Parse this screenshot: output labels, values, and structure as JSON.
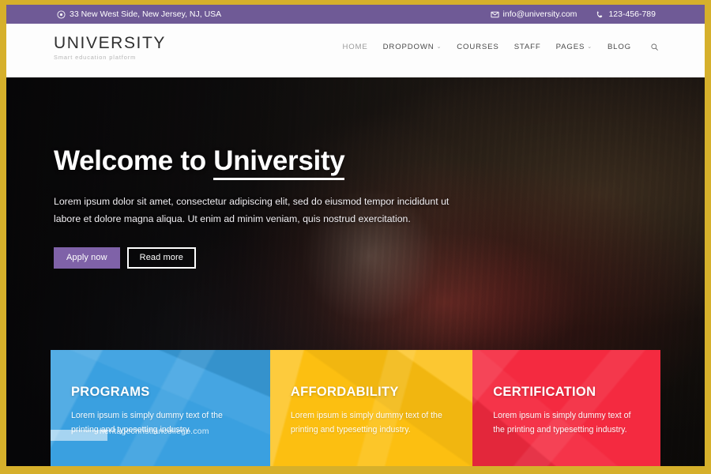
{
  "theme": {
    "frame_border": "#d6b02b",
    "topbar_bg": "#6f5a96",
    "accent_purple": "#7f62a8",
    "card_blue": "#3aa0e0",
    "card_yellow": "#fcbf11",
    "card_red": "#f42a40"
  },
  "topbar": {
    "address": "33 New West Side, New Jersey, NJ, USA",
    "email": "info@university.com",
    "phone": "123-456-789",
    "location_icon": "map-pin-icon",
    "email_icon": "envelope-icon",
    "phone_icon": "phone-icon"
  },
  "header": {
    "logo_title": "UNIVERSITY",
    "logo_tagline": "Smart education platform",
    "nav": [
      {
        "label": "HOME",
        "has_caret": false,
        "active": true
      },
      {
        "label": "DROPDOWN",
        "has_caret": true,
        "active": false
      },
      {
        "label": "COURSES",
        "has_caret": false,
        "active": false
      },
      {
        "label": "STAFF",
        "has_caret": false,
        "active": false
      },
      {
        "label": "PAGES",
        "has_caret": true,
        "active": false
      },
      {
        "label": "BLOG",
        "has_caret": false,
        "active": false
      }
    ],
    "caret_glyph": "⌄",
    "search_icon": "search-icon"
  },
  "hero": {
    "title_prefix": "Welcome to ",
    "title_highlight": "University",
    "paragraph": "Lorem ipsum dolor sit amet, consectetur adipiscing elit, sed do eiusmod tempor incididunt ut labore et dolore magna aliqua. Ut enim ad minim veniam, quis nostrud exercitation.",
    "primary_button": "Apply now",
    "secondary_button": "Read more"
  },
  "cards": [
    {
      "title": "PROGRAMS",
      "text": "Lorem ipsum is simply dummy text of the printing and typesetting industry."
    },
    {
      "title": "AFFORDABILITY",
      "text": "Lorem ipsum is simply dummy text of the printing and typesetting industry."
    },
    {
      "title": "CERTIFICATION",
      "text": "Lorem ipsum is simply dummy text of the printing and typesetting industry."
    }
  ],
  "watermark": "heritagechristiancollege.com"
}
